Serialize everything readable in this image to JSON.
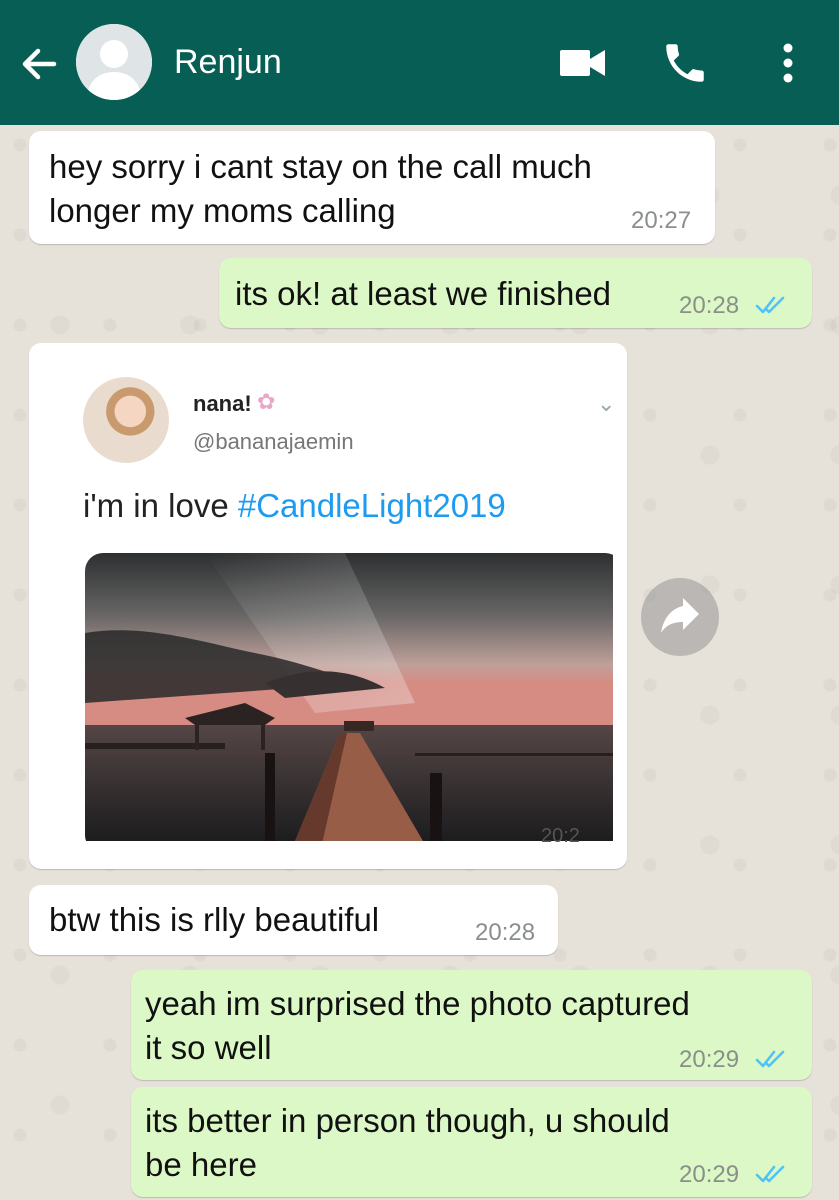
{
  "header": {
    "contact_name": "Renjun"
  },
  "messages": [
    {
      "direction": "in",
      "text_lines": [
        "hey sorry i cant stay on the call much",
        "longer my moms calling"
      ],
      "time": "20:27"
    },
    {
      "direction": "out",
      "text_lines": [
        "its ok! at least we finished"
      ],
      "time": "20:28",
      "status": "read"
    },
    {
      "direction": "in",
      "type": "image",
      "tweet": {
        "name": "nana!",
        "name_emoji": "✿",
        "handle": "@bananajaemin",
        "text": "i'm in love ",
        "hashtag": "#CandleLight2019"
      },
      "time_partial": "20:2"
    },
    {
      "direction": "in",
      "text_lines": [
        "btw this is rlly beautiful"
      ],
      "time": "20:28"
    },
    {
      "direction": "out",
      "text_lines": [
        "yeah im surprised the photo captured",
        "it so well"
      ],
      "time": "20:29",
      "status": "read"
    },
    {
      "direction": "out",
      "text_lines": [
        "its better in person though, u should",
        "be here"
      ],
      "time": "20:29",
      "status": "read"
    }
  ],
  "icons": {
    "back": "arrow-left-icon",
    "video": "videocam-icon",
    "call": "phone-icon",
    "menu": "more-vert-icon",
    "forward": "forward-icon",
    "tick": "double-check-icon"
  },
  "colors": {
    "appbar": "#075e54",
    "outgoing_bubble": "#dcf8c6",
    "incoming_bubble": "#ffffff",
    "read_tick": "#4fc3f7",
    "hashtag": "#1d9bf0"
  }
}
